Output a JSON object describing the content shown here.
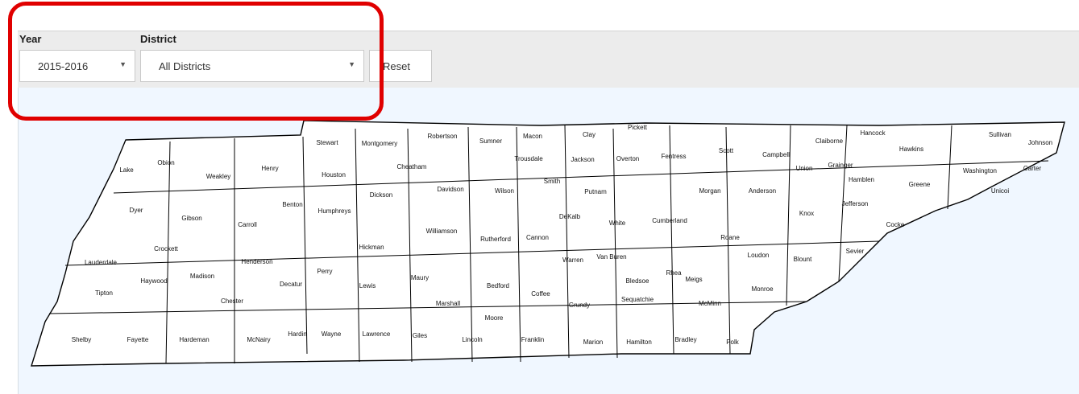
{
  "filters": {
    "year_label": "Year",
    "year_value": "2015-2016",
    "district_label": "District",
    "district_value": "All Districts",
    "reset_label": "Reset"
  },
  "map": {
    "region": "Tennessee",
    "fill": "#ffffff",
    "stroke": "#000000",
    "background": "#f0f7ff",
    "counties": [
      "Lake",
      "Obion",
      "Weakley",
      "Henry",
      "Stewart",
      "Montgomery",
      "Robertson",
      "Sumner",
      "Macon",
      "Clay",
      "Pickett",
      "Scott",
      "Campbell",
      "Claiborne",
      "Hancock",
      "Hawkins",
      "Sullivan",
      "Johnson",
      "Carter",
      "Unicoi",
      "Washington",
      "Greene",
      "Cocke",
      "Hamblen",
      "Jefferson",
      "Grainger",
      "Union",
      "Anderson",
      "Knox",
      "Sevier",
      "Blount",
      "Loudon",
      "Monroe",
      "Roane",
      "Morgan",
      "Fentress",
      "Overton",
      "Jackson",
      "Putnam",
      "Cumberland",
      "White",
      "Smith",
      "Trousdale",
      "Wilson",
      "Davidson",
      "Cheatham",
      "Dickson",
      "Houston",
      "Benton",
      "Humphreys",
      "Hickman",
      "Williamson",
      "Rutherford",
      "Cannon",
      "DeKalb",
      "Warren",
      "Van Buren",
      "Bledsoe",
      "Rhea",
      "Meigs",
      "McMinn",
      "Polk",
      "Bradley",
      "Hamilton",
      "Sequatchie",
      "Marion",
      "Grundy",
      "Franklin",
      "Coffee",
      "Bedford",
      "Moore",
      "Lincoln",
      "Marshall",
      "Maury",
      "Giles",
      "Lawrence",
      "Lewis",
      "Perry",
      "Wayne",
      "Hardin",
      "Decatur",
      "McNairy",
      "Chester",
      "Henderson",
      "Carroll",
      "Gibson",
      "Crockett",
      "Madison",
      "Hardeman",
      "Haywood",
      "Fayette",
      "Shelby",
      "Tipton",
      "Lauderdale",
      "Dyer"
    ]
  }
}
